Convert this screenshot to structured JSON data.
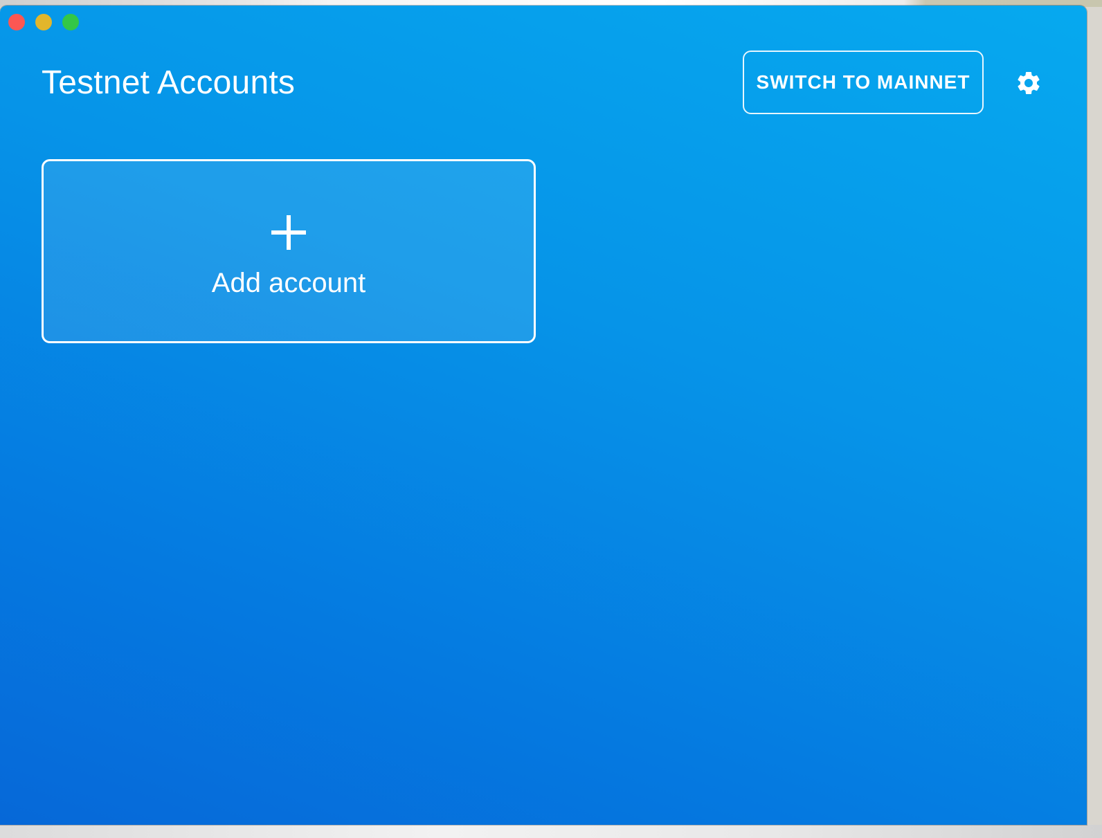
{
  "window": {
    "controls": [
      "close",
      "minimize",
      "maximize"
    ]
  },
  "header": {
    "title": "Testnet Accounts",
    "switch_label": "SWITCH TO MAINNET",
    "settings_icon": "gear-icon"
  },
  "main": {
    "add_card": {
      "icon": "plus-icon",
      "label": "Add account"
    }
  },
  "colors": {
    "background_top": "#06a9ef",
    "background_bottom": "#0668d8",
    "foreground": "#ffffff",
    "close": "#fc5753",
    "minimize": "#e2b62b",
    "maximize": "#33c748"
  }
}
